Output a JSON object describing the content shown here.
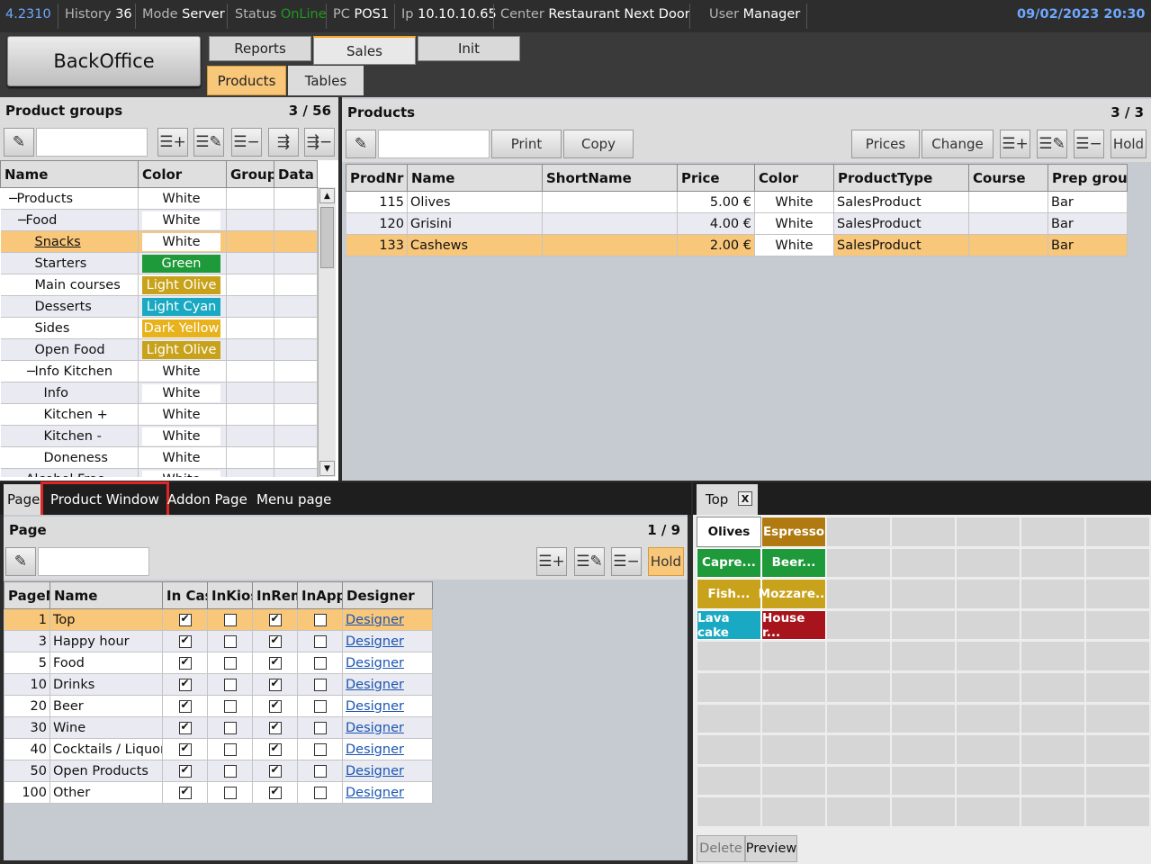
{
  "statusbar": {
    "version": "4.2310",
    "history_label": "History",
    "history_value": "36",
    "mode_label": "Mode",
    "mode_value": "Server",
    "status_label": "Status",
    "status_value": "OnLine",
    "pc_label": "PC",
    "pc_value": "POS1",
    "ip_label": "Ip",
    "ip_value": "10.10.10.65",
    "center_label": "Center",
    "center_value": "Restaurant Next Door",
    "user_label": "User",
    "user_value": "Manager",
    "datetime": "09/02/2023 20:30"
  },
  "header": {
    "app_button": "BackOffice",
    "top_tabs": [
      "Reports",
      "Sales",
      "Init"
    ],
    "active_top_tab": "Sales",
    "sub_tabs": [
      "Products",
      "Tables"
    ],
    "active_sub_tab": "Products"
  },
  "product_groups": {
    "title": "Product groups",
    "count": "3  /  56",
    "search_value": "",
    "columns": [
      "Name",
      "Color",
      "Group",
      "Data"
    ],
    "rows": [
      {
        "name": "Products",
        "color": "White",
        "indent": 0,
        "prefix": "−"
      },
      {
        "name": "Food",
        "color": "White",
        "indent": 1,
        "prefix": "−"
      },
      {
        "name": "Snacks",
        "color": "White",
        "indent": 2,
        "prefix": ""
      },
      {
        "name": "Starters",
        "color": "Green",
        "indent": 2,
        "prefix": ""
      },
      {
        "name": "Main courses",
        "color": "Light Olive",
        "indent": 2,
        "prefix": ""
      },
      {
        "name": "Desserts",
        "color": "Light Cyan",
        "indent": 2,
        "prefix": ""
      },
      {
        "name": "Sides",
        "color": "Dark Yellow",
        "indent": 2,
        "prefix": ""
      },
      {
        "name": "Open Food",
        "color": "Light Olive",
        "indent": 2,
        "prefix": ""
      },
      {
        "name": "Info Kitchen",
        "color": "White",
        "indent": 2,
        "prefix": "−"
      },
      {
        "name": "Info",
        "color": "White",
        "indent": 3,
        "prefix": ""
      },
      {
        "name": "Kitchen +",
        "color": "White",
        "indent": 3,
        "prefix": ""
      },
      {
        "name": "Kitchen -",
        "color": "White",
        "indent": 3,
        "prefix": ""
      },
      {
        "name": "Doneness",
        "color": "White",
        "indent": 3,
        "prefix": ""
      },
      {
        "name": "Alcohol Free",
        "color": "White",
        "indent": 1,
        "prefix": "−"
      }
    ],
    "selected": "Snacks",
    "color_map": {
      "White": "#ffffff",
      "Green": "#1e9a3a",
      "Light Olive": "#c8a21a",
      "Light Cyan": "#1aa9c2",
      "Dark Yellow": "#e8b21c"
    }
  },
  "products": {
    "title": "Products",
    "count": "3  /  3",
    "search_value": "",
    "buttons": {
      "print": "Print",
      "copy": "Copy",
      "prices": "Prices",
      "change": "Change",
      "hold": "Hold"
    },
    "columns": [
      "ProdNr",
      "Name",
      "ShortName",
      "Price",
      "Color",
      "ProductType",
      "Course",
      "Prep group"
    ],
    "rows": [
      {
        "prodnr": "115",
        "name": "Olives",
        "shortname": "",
        "price": "5.00 €",
        "color": "White",
        "type": "SalesProduct",
        "course": "",
        "prep": "Bar"
      },
      {
        "prodnr": "120",
        "name": "Grisini",
        "shortname": "",
        "price": "4.00 €",
        "color": "White",
        "type": "SalesProduct",
        "course": "",
        "prep": "Bar"
      },
      {
        "prodnr": "133",
        "name": "Cashews",
        "shortname": "",
        "price": "2.00 €",
        "color": "White",
        "type": "SalesProduct",
        "course": "",
        "prep": "Bar"
      }
    ],
    "selected": "133"
  },
  "bottom_tabs": {
    "tabs": [
      "Page",
      "Product Window",
      "Addon Page",
      "Menu page"
    ],
    "highlighted": "Product Window"
  },
  "page_panel": {
    "title": "Page",
    "count": "1  /  9",
    "search_value": "",
    "hold": "Hold",
    "columns": [
      "PageNr",
      "Name",
      "In Cash",
      "InKiosk",
      "InRemote",
      "InApp",
      "Designer"
    ],
    "rows": [
      {
        "nr": "1",
        "name": "Top",
        "cash": true,
        "kiosk": false,
        "remote": true,
        "app": false,
        "designer": "Designer"
      },
      {
        "nr": "3",
        "name": "Happy hour",
        "cash": true,
        "kiosk": false,
        "remote": true,
        "app": false,
        "designer": "Designer"
      },
      {
        "nr": "5",
        "name": "Food",
        "cash": true,
        "kiosk": false,
        "remote": true,
        "app": false,
        "designer": "Designer"
      },
      {
        "nr": "10",
        "name": "Drinks",
        "cash": true,
        "kiosk": false,
        "remote": true,
        "app": false,
        "designer": "Designer"
      },
      {
        "nr": "20",
        "name": "Beer",
        "cash": true,
        "kiosk": false,
        "remote": true,
        "app": false,
        "designer": "Designer"
      },
      {
        "nr": "30",
        "name": "Wine",
        "cash": true,
        "kiosk": false,
        "remote": true,
        "app": false,
        "designer": "Designer"
      },
      {
        "nr": "40",
        "name": "Cocktails / Liquor",
        "cash": true,
        "kiosk": false,
        "remote": true,
        "app": false,
        "designer": "Designer"
      },
      {
        "nr": "50",
        "name": "Open Products",
        "cash": true,
        "kiosk": false,
        "remote": true,
        "app": false,
        "designer": "Designer"
      },
      {
        "nr": "100",
        "name": "Other",
        "cash": true,
        "kiosk": false,
        "remote": true,
        "app": false,
        "designer": "Designer"
      }
    ],
    "selected": "1"
  },
  "designer": {
    "page_tab": "Top",
    "close_label": "X",
    "tiles": [
      {
        "label": "Olives",
        "bg": "#ffffff",
        "fg": "#111111"
      },
      {
        "label": "Espresso",
        "bg": "#b07a10",
        "fg": "#ffffff"
      },
      {
        "label": "Capre...",
        "bg": "#1e9a3a",
        "fg": "#ffffff"
      },
      {
        "label": "Beer...",
        "bg": "#1e9a3a",
        "fg": "#ffffff"
      },
      {
        "label": "Fish...",
        "bg": "#c8a21a",
        "fg": "#ffffff"
      },
      {
        "label": "Mozzare...",
        "bg": "#c8a21a",
        "fg": "#ffffff"
      },
      {
        "label": "Lava cake",
        "bg": "#1aa9c2",
        "fg": "#ffffff"
      },
      {
        "label": "House r...",
        "bg": "#a8141c",
        "fg": "#ffffff"
      }
    ],
    "delete_label": "Delete",
    "preview_label": "Preview"
  }
}
